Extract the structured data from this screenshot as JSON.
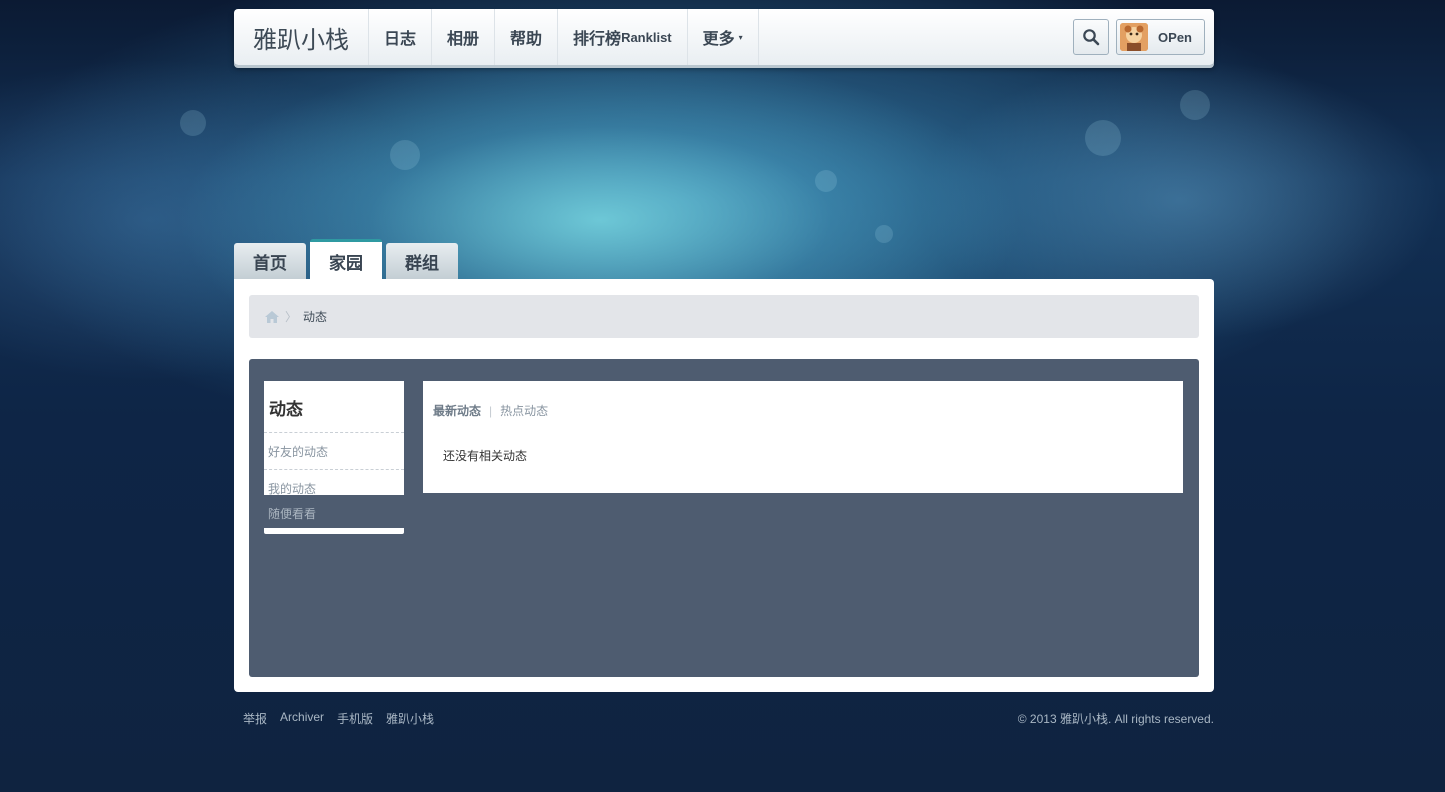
{
  "site": {
    "logo": "雅趴小栈"
  },
  "nav": {
    "items": [
      {
        "label": "日志"
      },
      {
        "label": "相册"
      },
      {
        "label": "帮助"
      },
      {
        "label_main": "排行榜",
        "label_small": "Ranklist"
      },
      {
        "label": "更多",
        "caret": "▾"
      }
    ]
  },
  "user": {
    "name": "OPen"
  },
  "tabs": [
    {
      "label": "首页"
    },
    {
      "label": "家园",
      "active": true
    },
    {
      "label": "群组"
    }
  ],
  "breadcrumb": {
    "current": "动态",
    "separator": "〉"
  },
  "sidebar": {
    "title": "动态",
    "items": [
      {
        "label": "好友的动态"
      },
      {
        "label": "我的动态"
      }
    ],
    "extra": "随便看看"
  },
  "feed": {
    "tabs": [
      {
        "label": "最新动态",
        "active": true
      },
      {
        "label": "热点动态"
      }
    ],
    "separator": "|",
    "empty_message": "还没有相关动态"
  },
  "footer": {
    "links": [
      "举报",
      "Archiver",
      "手机版",
      "雅趴小栈"
    ],
    "copyright": "© 2013 雅趴小栈. All rights reserved."
  },
  "colors": {
    "accent": "#2f9aa2",
    "panel": "#4e5c70"
  }
}
